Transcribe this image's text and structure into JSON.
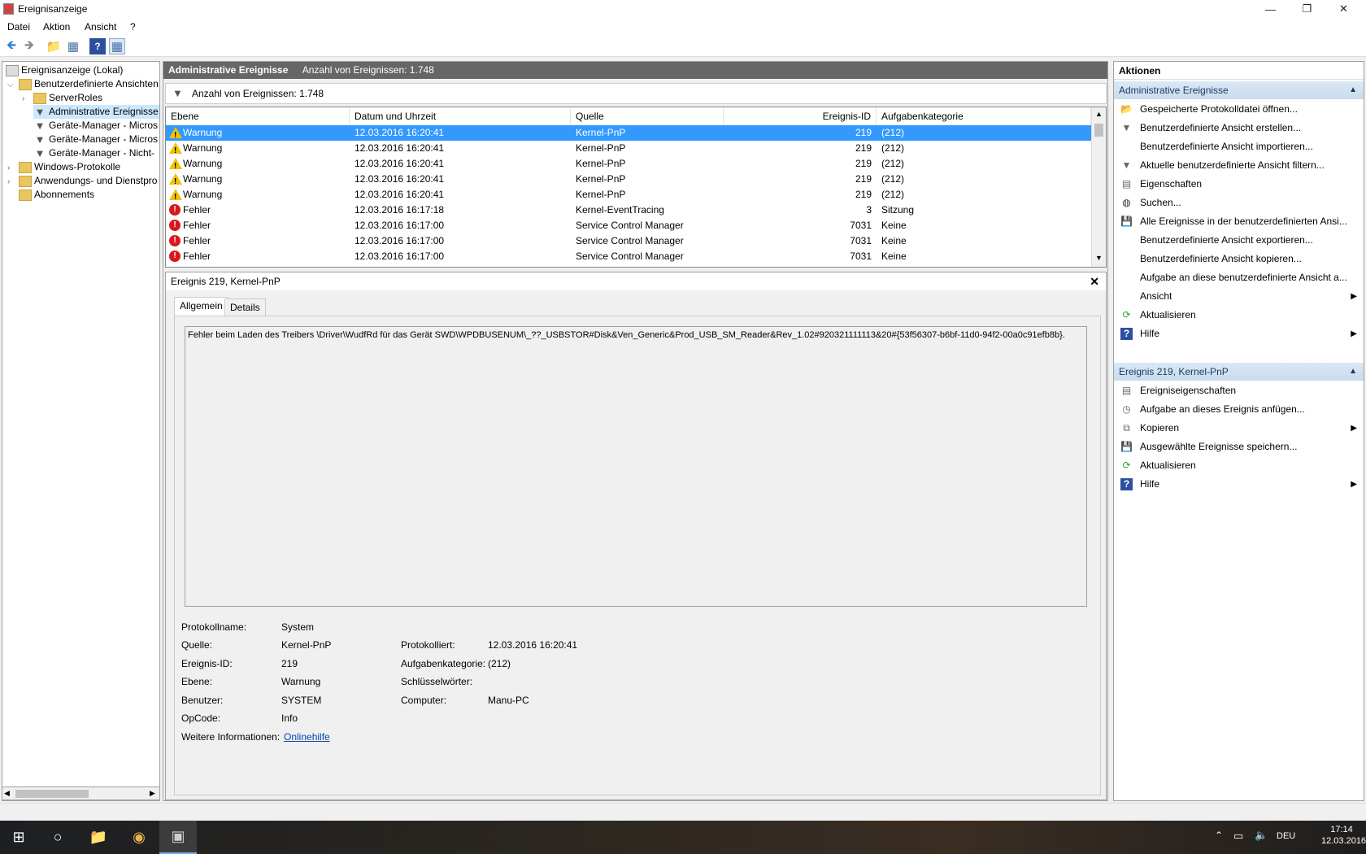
{
  "window": {
    "title": "Ereignisanzeige"
  },
  "menu": [
    "Datei",
    "Aktion",
    "Ansicht",
    "?"
  ],
  "tree": {
    "items": [
      {
        "label": "Ereignisanzeige (Lokal)"
      },
      {
        "label": "Benutzerdefinierte Ansichten"
      },
      {
        "label": "ServerRoles"
      },
      {
        "label": "Administrative Ereignisse"
      },
      {
        "label": "Geräte-Manager - Micros"
      },
      {
        "label": "Geräte-Manager - Micros"
      },
      {
        "label": "Geräte-Manager - Nicht-"
      },
      {
        "label": "Windows-Protokolle"
      },
      {
        "label": "Anwendungs- und Dienstpro"
      },
      {
        "label": "Abonnements"
      }
    ]
  },
  "center": {
    "header_title": "Administrative Ereignisse",
    "header_count": "Anzahl von Ereignissen: 1.748",
    "filter_text": "Anzahl von Ereignissen: 1.748",
    "columns": [
      "Ebene",
      "Datum und Uhrzeit",
      "Quelle",
      "Ereignis-ID",
      "Aufgabenkategorie"
    ],
    "rows": [
      {
        "level": "Warnung",
        "type": "warn",
        "date": "12.03.2016 16:20:41",
        "source": "Kernel-PnP",
        "id": "219",
        "cat": "(212)"
      },
      {
        "level": "Warnung",
        "type": "warn",
        "date": "12.03.2016 16:20:41",
        "source": "Kernel-PnP",
        "id": "219",
        "cat": "(212)"
      },
      {
        "level": "Warnung",
        "type": "warn",
        "date": "12.03.2016 16:20:41",
        "source": "Kernel-PnP",
        "id": "219",
        "cat": "(212)"
      },
      {
        "level": "Warnung",
        "type": "warn",
        "date": "12.03.2016 16:20:41",
        "source": "Kernel-PnP",
        "id": "219",
        "cat": "(212)"
      },
      {
        "level": "Warnung",
        "type": "warn",
        "date": "12.03.2016 16:20:41",
        "source": "Kernel-PnP",
        "id": "219",
        "cat": "(212)"
      },
      {
        "level": "Fehler",
        "type": "err",
        "date": "12.03.2016 16:17:18",
        "source": "Kernel-EventTracing",
        "id": "3",
        "cat": "Sitzung"
      },
      {
        "level": "Fehler",
        "type": "err",
        "date": "12.03.2016 16:17:00",
        "source": "Service Control Manager",
        "id": "7031",
        "cat": "Keine"
      },
      {
        "level": "Fehler",
        "type": "err",
        "date": "12.03.2016 16:17:00",
        "source": "Service Control Manager",
        "id": "7031",
        "cat": "Keine"
      },
      {
        "level": "Fehler",
        "type": "err",
        "date": "12.03.2016 16:17:00",
        "source": "Service Control Manager",
        "id": "7031",
        "cat": "Keine"
      }
    ]
  },
  "detail": {
    "title": "Ereignis 219, Kernel-PnP",
    "tabs": [
      "Allgemein",
      "Details"
    ],
    "message": "Fehler beim Laden des Treibers \\Driver\\WudfRd für das Gerät SWD\\WPDBUSENUM\\_??_USBSTOR#Disk&Ven_Generic&Prod_USB_SM_Reader&Rev_1.02#920321111113&20#{53f56307-b6bf-11d0-94f2-00a0c91efb8b}.",
    "fields": {
      "protokollname_label": "Protokollname:",
      "protokollname": "System",
      "quelle_label": "Quelle:",
      "quelle": "Kernel-PnP",
      "protokolliert_label": "Protokolliert:",
      "protokolliert": "12.03.2016 16:20:41",
      "id_label": "Ereignis-ID:",
      "id": "219",
      "aufgabe_label": "Aufgabenkategorie:",
      "aufgabe": "(212)",
      "ebene_label": "Ebene:",
      "ebene": "Warnung",
      "schluessel_label": "Schlüsselwörter:",
      "schluessel": "",
      "benutzer_label": "Benutzer:",
      "benutzer": "SYSTEM",
      "computer_label": "Computer:",
      "computer": "Manu-PC",
      "opcode_label": "OpCode:",
      "opcode": "Info",
      "weitere_label": "Weitere Informationen:",
      "weitere_link": "Onlinehilfe"
    }
  },
  "actions": {
    "title": "Aktionen",
    "section1": "Administrative Ereignisse",
    "items1": [
      {
        "label": "Gespeicherte Protokolldatei öffnen...",
        "icon": "open-folder-icon"
      },
      {
        "label": "Benutzerdefinierte Ansicht erstellen...",
        "icon": "filter-icon"
      },
      {
        "label": "Benutzerdefinierte Ansicht importieren...",
        "icon": ""
      },
      {
        "label": "Aktuelle benutzerdefinierte Ansicht filtern...",
        "icon": "filter-icon"
      },
      {
        "label": "Eigenschaften",
        "icon": "properties-icon"
      },
      {
        "label": "Suchen...",
        "icon": "binoculars-icon"
      },
      {
        "label": "Alle Ereignisse in der benutzerdefinierten Ansi...",
        "icon": "save-icon"
      },
      {
        "label": "Benutzerdefinierte Ansicht exportieren...",
        "icon": ""
      },
      {
        "label": "Benutzerdefinierte Ansicht kopieren...",
        "icon": ""
      },
      {
        "label": "Aufgabe an diese benutzerdefinierte Ansicht a...",
        "icon": ""
      },
      {
        "label": "Ansicht",
        "icon": "",
        "submenu": true
      },
      {
        "label": "Aktualisieren",
        "icon": "refresh-icon"
      },
      {
        "label": "Hilfe",
        "icon": "help-icon",
        "submenu": true
      }
    ],
    "section2": "Ereignis 219, Kernel-PnP",
    "items2": [
      {
        "label": "Ereigniseigenschaften",
        "icon": "properties-icon"
      },
      {
        "label": "Aufgabe an dieses Ereignis anfügen...",
        "icon": "task-icon"
      },
      {
        "label": "Kopieren",
        "icon": "copy-icon",
        "submenu": true
      },
      {
        "label": "Ausgewählte Ereignisse speichern...",
        "icon": "save-icon"
      },
      {
        "label": "Aktualisieren",
        "icon": "refresh-icon"
      },
      {
        "label": "Hilfe",
        "icon": "help-icon",
        "submenu": true
      }
    ]
  },
  "taskbar": {
    "lang": "DEU",
    "time": "17:14",
    "date": "12.03.2016"
  }
}
